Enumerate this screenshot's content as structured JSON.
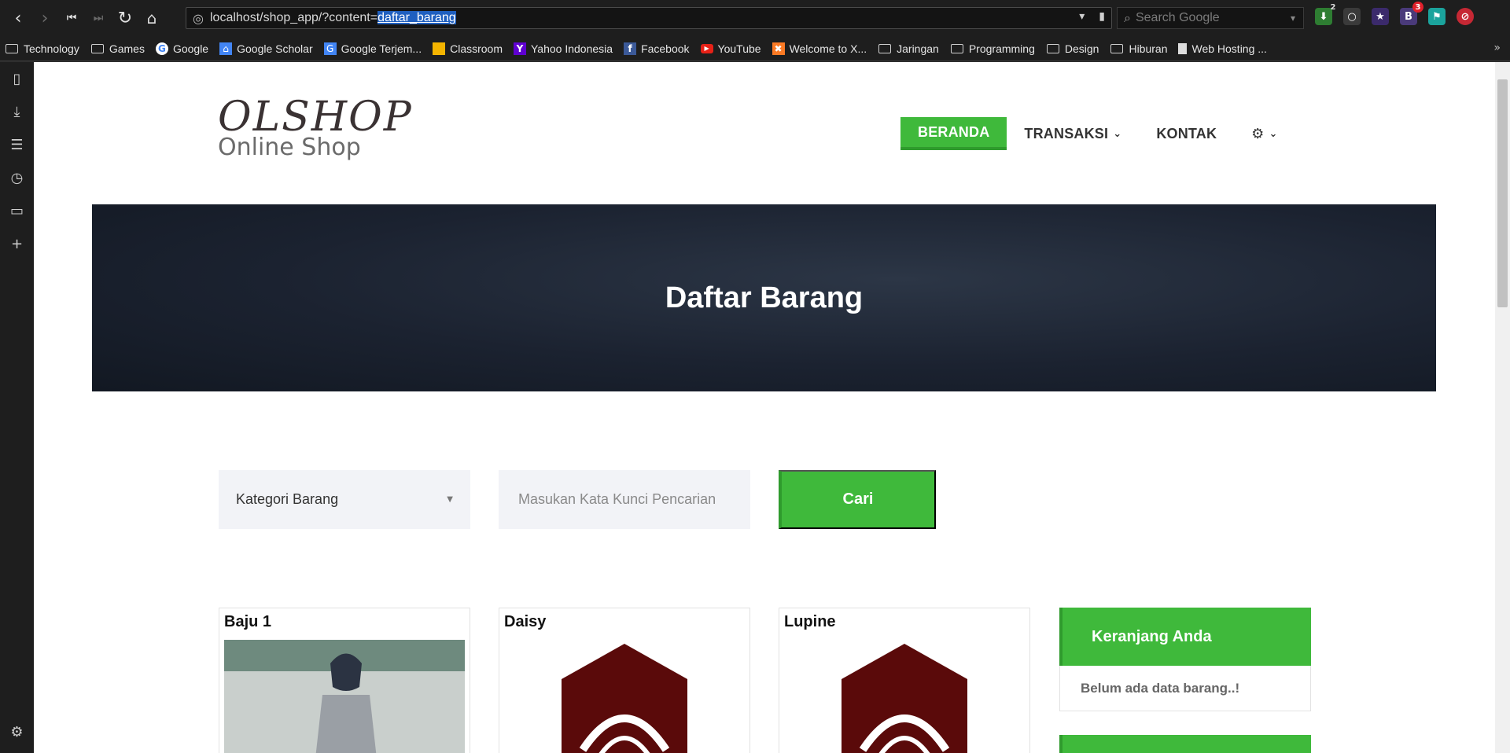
{
  "browser": {
    "url_prefix": "localhost/shop_app/?content=",
    "url_selected": "daftar_barang",
    "search_placeholder": "Search Google",
    "extensions": [
      {
        "name": "download-manager",
        "badge": "2",
        "color": "#4caf50"
      },
      {
        "name": "lightbulb",
        "badge": "",
        "color": "#555555"
      },
      {
        "name": "twitch",
        "badge": "",
        "color": "#3b2a6b"
      },
      {
        "name": "b-extension",
        "badge": "3",
        "color": "#4a3a7a"
      },
      {
        "name": "flag",
        "badge": "",
        "color": "#1ba39c"
      },
      {
        "name": "blocker",
        "badge": "",
        "color": "#d0303a"
      }
    ]
  },
  "bookmarks": [
    {
      "label": "Technology",
      "icon": "folder-icon"
    },
    {
      "label": "Games",
      "icon": "folder-icon"
    },
    {
      "label": "Google",
      "icon": "google-icon"
    },
    {
      "label": "Google Scholar",
      "icon": "scholar-icon"
    },
    {
      "label": "Google Terjem...",
      "icon": "translate-icon"
    },
    {
      "label": "Classroom",
      "icon": "classroom-icon"
    },
    {
      "label": "Yahoo Indonesia",
      "icon": "yahoo-icon"
    },
    {
      "label": "Facebook",
      "icon": "facebook-icon"
    },
    {
      "label": "YouTube",
      "icon": "youtube-icon"
    },
    {
      "label": "Welcome to X...",
      "icon": "xampp-icon"
    },
    {
      "label": "Jaringan",
      "icon": "folder-icon"
    },
    {
      "label": "Programming",
      "icon": "folder-icon"
    },
    {
      "label": "Design",
      "icon": "folder-icon"
    },
    {
      "label": "Hiburan",
      "icon": "folder-icon"
    },
    {
      "label": "Web Hosting ...",
      "icon": "page-icon"
    }
  ],
  "logo": {
    "main": "OLSHOP",
    "sub": "Online Shop"
  },
  "nav": {
    "beranda": "BERANDA",
    "transaksi": "TRANSAKSI",
    "kontak": "KONTAK"
  },
  "hero": {
    "title": "Daftar Barang"
  },
  "filter": {
    "category_selected": "Kategori Barang",
    "search_placeholder": "Masukan Kata Kunci Pencarian",
    "search_button": "Cari"
  },
  "products": [
    {
      "name": "Baju 1"
    },
    {
      "name": "Daisy"
    },
    {
      "name": "Lupine"
    }
  ],
  "cart": {
    "title": "Keranjang Anda",
    "empty_text": "Belum ada data barang..!"
  },
  "colors": {
    "accent": "#3fb93b",
    "accent_dark": "#2f9b2d",
    "hero_bg": "#1b2230"
  }
}
